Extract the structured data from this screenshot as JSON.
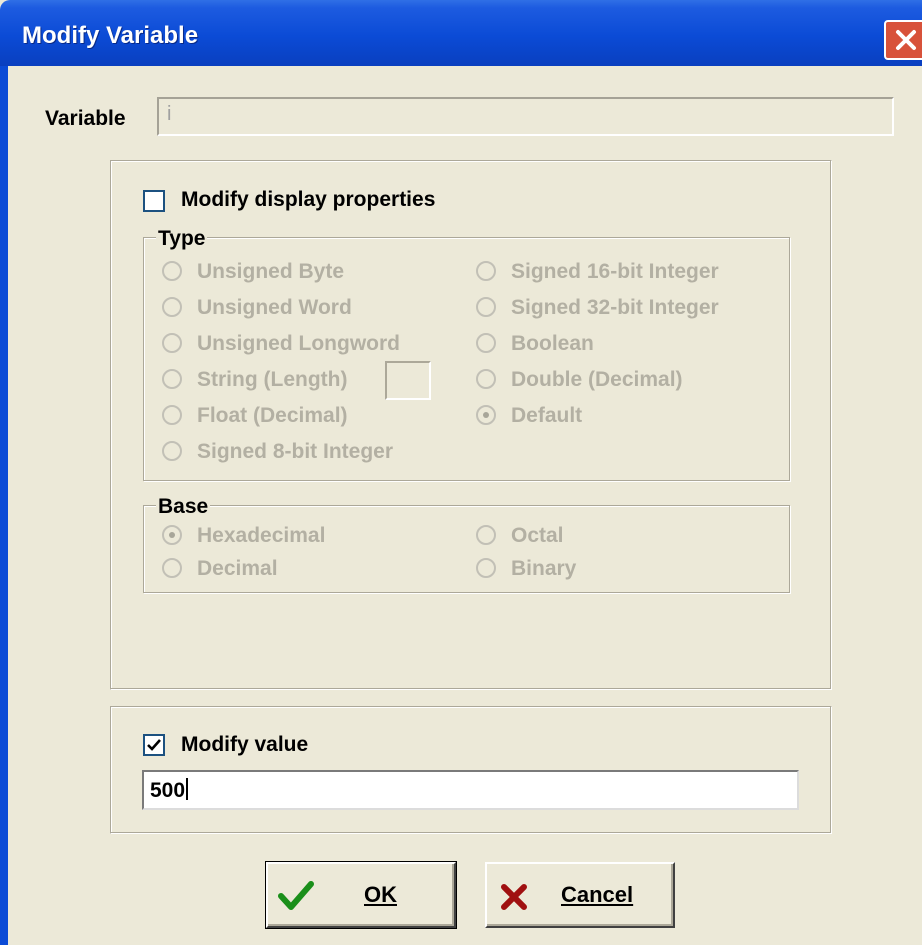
{
  "window": {
    "title": "Modify Variable"
  },
  "variable": {
    "label": "Variable",
    "value": "i"
  },
  "display": {
    "checkbox_label": "Modify display properties",
    "checked": false
  },
  "type_group": {
    "legend": "Type",
    "options": [
      "Unsigned Byte",
      "Unsigned Word",
      "Unsigned Longword",
      "String (Length)",
      "Float (Decimal)",
      "Signed 8-bit Integer",
      "Signed 16-bit Integer",
      "Signed 32-bit Integer",
      "Boolean",
      "Double (Decimal)",
      "Default"
    ],
    "selected": "Default",
    "enabled": false
  },
  "base_group": {
    "legend": "Base",
    "options": [
      "Hexadecimal",
      "Decimal",
      "Octal",
      "Binary"
    ],
    "selected": "Hexadecimal",
    "enabled": false
  },
  "modify_value": {
    "checkbox_label": "Modify value",
    "checked": true,
    "value": "500"
  },
  "buttons": {
    "ok": {
      "label": "OK",
      "icon": "checkmark-icon",
      "accent": "#1a8f1a"
    },
    "cancel": {
      "label": "Cancel",
      "icon": "x-mark-icon",
      "accent": "#a01010"
    }
  },
  "colors": {
    "title_bar": "#0b4bd6",
    "dialog_bg": "#ece9d8",
    "disabled_text": "#b3b0a3"
  }
}
